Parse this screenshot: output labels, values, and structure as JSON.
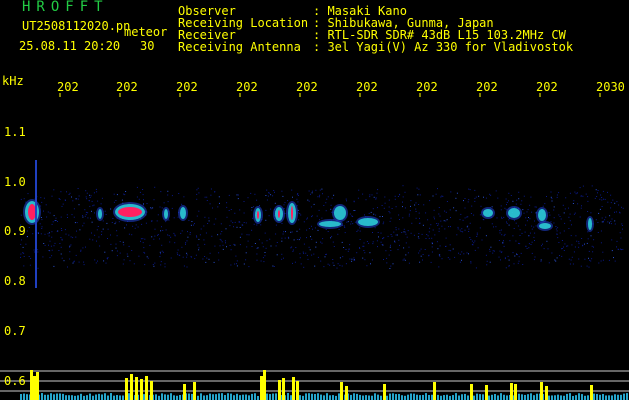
{
  "brand": "HROFFT",
  "file": {
    "name": "UT2508112020.pn",
    "kind": "meteor",
    "datetime": "25.08.11 20:20",
    "duration": "30"
  },
  "info": {
    "labels": [
      "Observer",
      "Receiving Location",
      "Receiver",
      "Receiving Antenna"
    ],
    "values": [
      ": Masaki Kano",
      ": Shibukawa, Gunma, Japan",
      ": RTL-SDR SDR# 43dB L15 103.2MHz CW",
      ": 3el Yagi(V) Az 330 for Vladivostok"
    ]
  },
  "axis": {
    "unit": "kHz",
    "y_labels": [
      "1.1",
      "1.0",
      "0.9",
      "0.8",
      "0.7",
      "0.6"
    ],
    "x_labels": [
      "202",
      "202",
      "202",
      "202",
      "202",
      "202",
      "202",
      "202",
      "202",
      "2030"
    ]
  },
  "colors": {
    "background": "#000000",
    "brand": "#22cc44",
    "label": "#ffff00",
    "noise": "#0a1a8a",
    "echo_hot": "#ff2060",
    "echo_cool": "#30e0e0",
    "bars": "#ffff00"
  }
}
